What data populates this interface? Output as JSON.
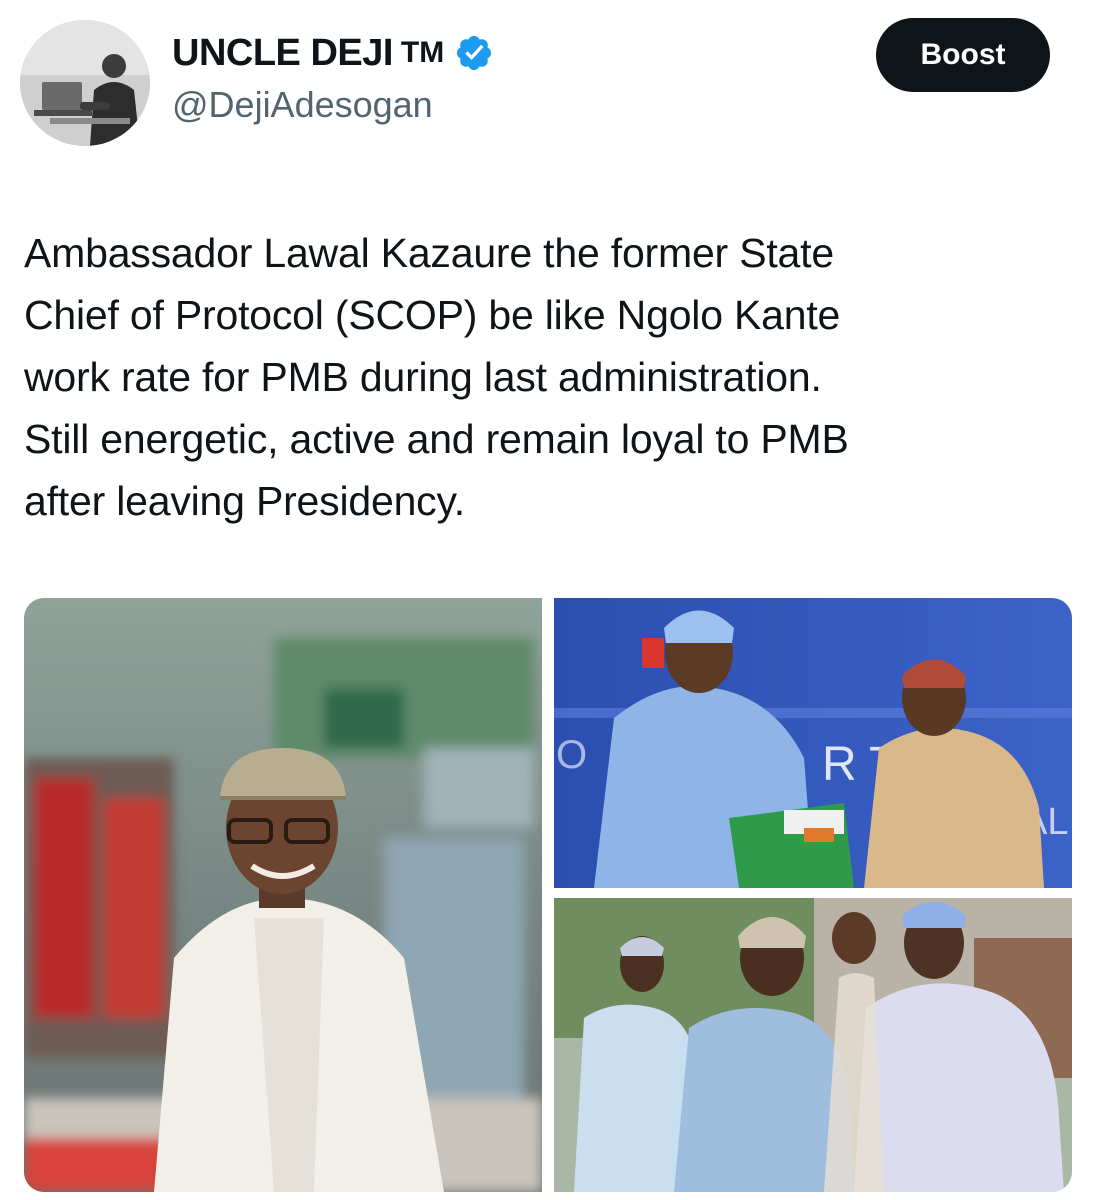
{
  "author": {
    "display_name": "UNCLE DEJI",
    "trademark": "TM",
    "handle": "@DejiAdesogan",
    "verified": true,
    "avatar_icon": "profile-photo-avatar"
  },
  "actions": {
    "boost_label": "Boost"
  },
  "tweet": {
    "lines": [
      "Ambassador Lawal Kazaure the former State",
      "Chief of Protocol (SCOP) be like Ngolo Kante",
      "work rate for PMB during last administration.",
      "Still energetic, active and remain loyal to PMB",
      "after leaving Presidency."
    ]
  },
  "media": {
    "count": 3,
    "photo_banner_fragment_left": "O",
    "photo_banner_fragment_right": "R  THE",
    "photo_banner_fragment_side": "AL"
  },
  "colors": {
    "text_primary": "#0f1419",
    "text_secondary": "#536471",
    "verified_blue": "#1d9bf0",
    "boost_bg": "#0f1419"
  }
}
